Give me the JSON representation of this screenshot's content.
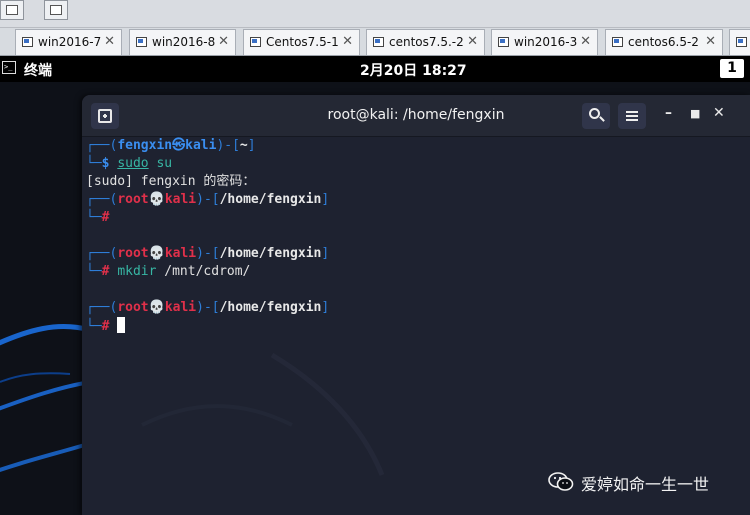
{
  "vm_tabs": [
    {
      "label": "win2016-7"
    },
    {
      "label": "win2016-8"
    },
    {
      "label": "Centos7.5-1"
    },
    {
      "label": "centos7.5.-2"
    },
    {
      "label": "win2016-3"
    },
    {
      "label": "centos6.5-2"
    }
  ],
  "gnome": {
    "app_name": "终端",
    "clock": "2月20日  18:27",
    "workspace": "1"
  },
  "terminal": {
    "title": "root@kali: /home/fengxin",
    "lines": {
      "l1_user": "fengxin",
      "l1_sep": "㉿",
      "l1_host": "kali",
      "l1_path": "~",
      "l2_cmd": "sudo",
      "l2_arg": " su",
      "l3_text": "[sudo] fengxin 的密码：",
      "p1_user": "root",
      "p1_host": "kali",
      "p1_path": "/home/fengxin",
      "p2_user": "root",
      "p2_host": "kali",
      "p2_path": "/home/fengxin",
      "p2_cmd": "mkdir",
      "p2_arg": " /mnt/cdrom/",
      "p3_user": "root",
      "p3_host": "kali",
      "p3_path": "/home/fengxin"
    }
  },
  "watermark": {
    "text": "爱婷如命一生一世"
  },
  "colors": {
    "terminal_bg": "#1e2230",
    "prompt_blue": "#3a8ef0",
    "root_red": "#e0304a",
    "cmd_teal": "#37b6a4"
  }
}
